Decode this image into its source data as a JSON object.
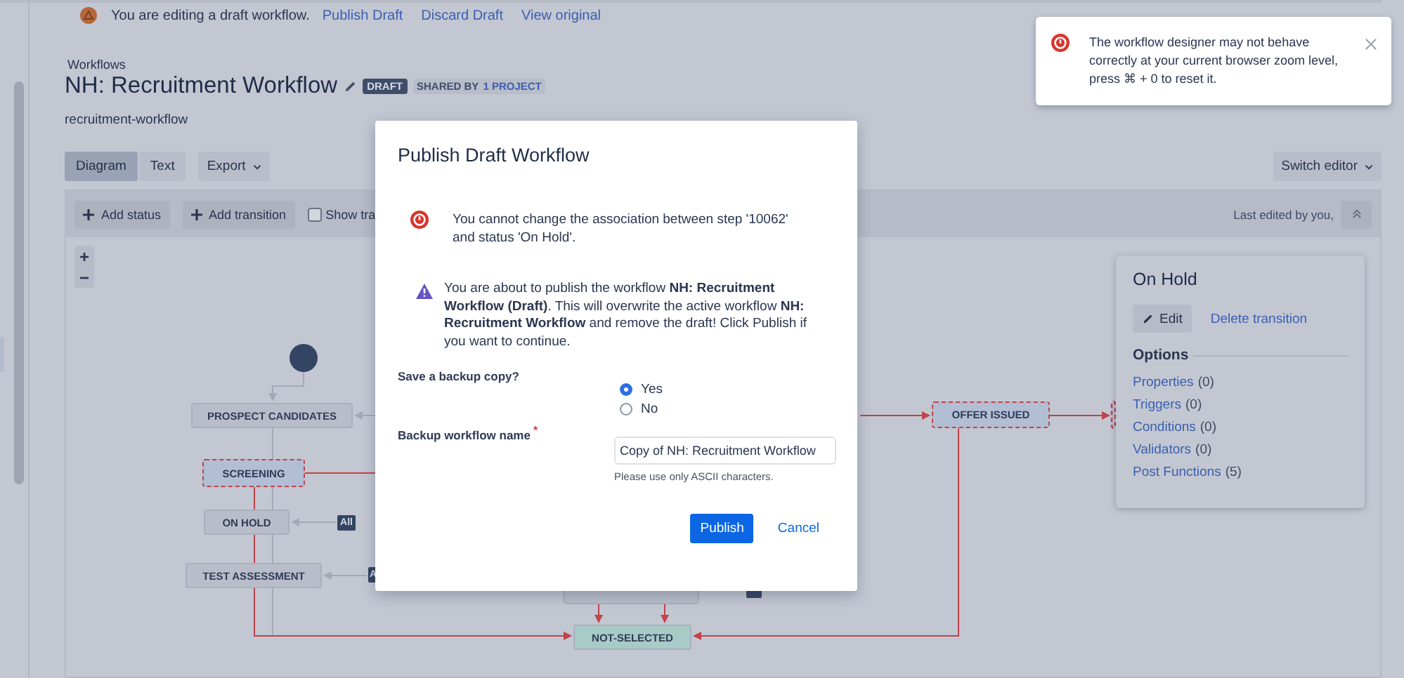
{
  "draft_banner": {
    "message": "You are editing a draft workflow.",
    "links": [
      "Publish Draft",
      "Discard Draft",
      "View original"
    ]
  },
  "header": {
    "breadcrumb": "Workflows",
    "title": "NH: Recruitment Workflow",
    "status_badge": "DRAFT",
    "shared_label": "SHARED BY",
    "shared_link": "1 PROJECT",
    "subtitle": "recruitment-workflow"
  },
  "view_tabs": [
    {
      "label": "Diagram",
      "selected": true
    },
    {
      "label": "Text",
      "selected": false
    }
  ],
  "export_button": "Export",
  "switch_editor_button": "Switch editor",
  "diagram_toolbar": {
    "buttons": [
      "Add status",
      "Add transition"
    ],
    "show_checkbox": {
      "label": "Show tra",
      "checked": false
    },
    "last_edited": "Last edited by you,"
  },
  "zoom_controls": [
    "+",
    "−"
  ],
  "diagram": {
    "statuses": [
      {
        "label": "PROSPECT CANDIDATES",
        "color": "#b8bdc9",
        "highlighted": false
      },
      {
        "label": "SCREENING",
        "color": "#b2bed4",
        "highlighted": true
      },
      {
        "label": "ON HOLD",
        "color": "#b8bdc9",
        "highlighted": false
      },
      {
        "label": "TEST ASSESSMENT",
        "color": "#b8bdc9",
        "highlighted": false
      },
      {
        "label": "OFFER ISSUED",
        "color": "#b2bed4",
        "highlighted": true
      },
      {
        "label": "NOT-SELECTED",
        "color": "#a7cbc6",
        "highlighted": false
      }
    ],
    "badges": [
      "All",
      "A"
    ]
  },
  "inspector": {
    "title": "On Hold",
    "edit_button": "Edit",
    "delete_link": "Delete transition",
    "options_heading": "Options",
    "options": [
      {
        "label": "Properties",
        "count": "(0)"
      },
      {
        "label": "Triggers",
        "count": "(0)"
      },
      {
        "label": "Conditions",
        "count": "(0)"
      },
      {
        "label": "Validators",
        "count": "(0)"
      },
      {
        "label": "Post Functions",
        "count": "(5)"
      }
    ]
  },
  "toast": {
    "message": "The workflow designer may not behave correctly at your current browser zoom level, press ⌘ + 0 to reset it."
  },
  "dialog": {
    "title": "Publish Draft Workflow",
    "error": "You cannot change the association between step '10062' and status 'On Hold'.",
    "warning": "You are about to publish the workflow **NH: Recruitment Workflow (Draft)**. This will overwrite the active workflow **NH: Recruitment Workflow** and remove the draft! Click Publish if you want to continue.",
    "backup_label": "Save a backup copy?",
    "backup_options": [
      {
        "label": "Yes",
        "selected": true
      },
      {
        "label": "No",
        "selected": false
      }
    ],
    "name_label": "Backup workflow name",
    "required_mark": "*",
    "name_value": "Copy of NH: Recruitment Workflow",
    "name_hint": "Please use only ASCII characters.",
    "primary_button": "Publish",
    "cancel_link": "Cancel"
  }
}
